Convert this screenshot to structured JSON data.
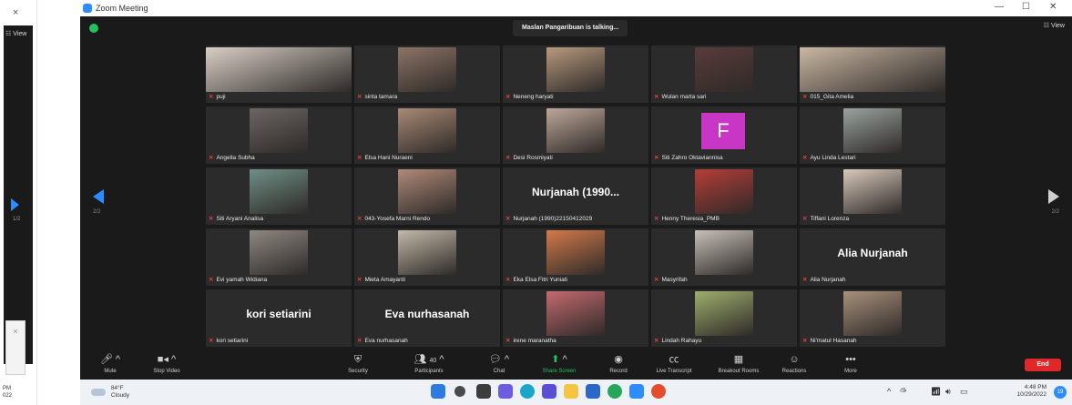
{
  "window": {
    "title": "Zoom Meeting",
    "minimize": "—",
    "restore": "☐",
    "close": "✕"
  },
  "left_panel": {
    "close": "×",
    "view": "☷ View",
    "page": "1/2",
    "notif_close": "×",
    "clock_time": "PM",
    "clock_date": "022"
  },
  "meeting": {
    "talking": "Maslan Pangaribuan is talking...",
    "view_label": "☷ View",
    "page_left": "2/2",
    "page_right": "2/2"
  },
  "participants": [
    {
      "name": "puji",
      "bg": "#d8cfc6"
    },
    {
      "name": "sinta tamara",
      "bg": "#8c7466"
    },
    {
      "name": "Neneng haryati",
      "bg": "#b79a7e"
    },
    {
      "name": "Wulan marta sari",
      "bg": "#5a3b3b"
    },
    {
      "name": "015_Gita Amelia",
      "bg": "#c9b7a3"
    },
    {
      "name": "Angella Subha",
      "bg": "#6c6563"
    },
    {
      "name": "Elsa Hani Nuraeni",
      "bg": "#a98a76"
    },
    {
      "name": "Desi Rosmiyati",
      "bg": "#bea89a"
    },
    {
      "name": "Siti Zahro Oktaviannisa",
      "initial": "F"
    },
    {
      "name": "Ayu Linda Lestari",
      "bg": "#9aa3a0"
    },
    {
      "name": "Siti Aryani Analisa",
      "bg": "#6f8f86"
    },
    {
      "name": "043-Yosefa Marni Rendo",
      "bg": "#b08a78"
    },
    {
      "name": "Nurjanah (1990)22150412029",
      "big": "Nurjanah (1990..."
    },
    {
      "name": "Henny Theresia_PMB",
      "bg": "#b73d38"
    },
    {
      "name": "Tiffani Lorenza",
      "bg": "#d8c9bb"
    },
    {
      "name": "Evi yamah Widiana",
      "bg": "#8e8882"
    },
    {
      "name": "Mieta Amayanti",
      "bg": "#c2b9a8"
    },
    {
      "name": "Eka Elsa Fitri Yuniati",
      "bg": "#d37a4a"
    },
    {
      "name": "Masyrifah",
      "bg": "#c6c0b8"
    },
    {
      "name": "Alia Nurjanah",
      "big": "Alia Nurjanah"
    },
    {
      "name": "kori setiarini",
      "big": "kori setiarini"
    },
    {
      "name": "Eva nurhasanah",
      "big": "Eva nurhasanah"
    },
    {
      "name": "irene maranatha",
      "bg": "#c46a6f"
    },
    {
      "name": "Lindah Rahayu",
      "bg": "#9eae6d"
    },
    {
      "name": "Ni'matul Hasanah",
      "bg": "#a8917c"
    }
  ],
  "toolbar": {
    "mute": "Mute",
    "stop_video": "Stop Video",
    "security": "Security",
    "participants": "Participants",
    "participants_count": "40",
    "chat": "Chat",
    "share_screen": "Share Screen",
    "record": "Record",
    "live_transcript": "Live Transcript",
    "breakout_rooms": "Breakout Rooms",
    "reactions": "Reactions",
    "more": "More",
    "end": "End"
  },
  "taskbar": {
    "temp": "84°F",
    "weather": "Cloudy",
    "time": "4:48 PM",
    "date": "10/29/2022",
    "notifications": "19"
  }
}
